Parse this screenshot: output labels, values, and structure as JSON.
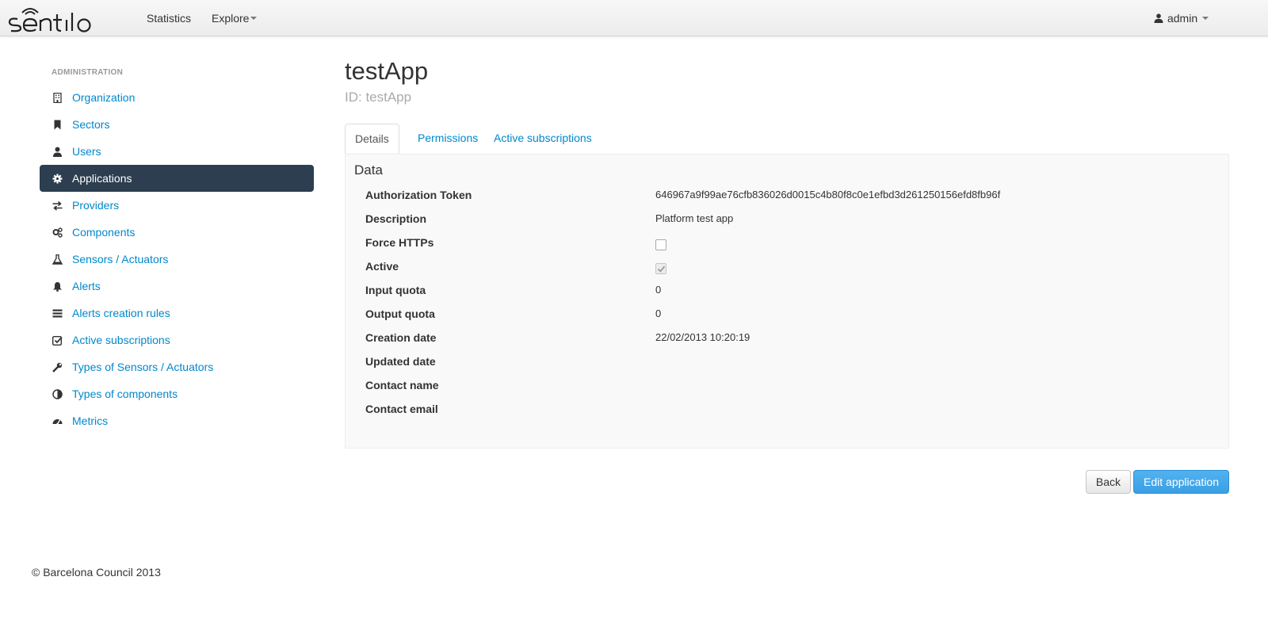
{
  "brand": {
    "name": "sentilo"
  },
  "navbar": {
    "statistics": "Statistics",
    "explore": "Explore",
    "user": "admin"
  },
  "sidebar": {
    "header": "ADMINISTRATION",
    "items": [
      {
        "label": "Organization",
        "icon": "building-icon"
      },
      {
        "label": "Sectors",
        "icon": "bookmark-icon"
      },
      {
        "label": "Users",
        "icon": "user-icon"
      },
      {
        "label": "Applications",
        "icon": "gear-icon"
      },
      {
        "label": "Providers",
        "icon": "exchange-icon"
      },
      {
        "label": "Components",
        "icon": "gears-icon"
      },
      {
        "label": "Sensors / Actuators",
        "icon": "flask-icon"
      },
      {
        "label": "Alerts",
        "icon": "bell-icon"
      },
      {
        "label": "Alerts creation rules",
        "icon": "list-icon"
      },
      {
        "label": "Active subscriptions",
        "icon": "check-square-icon"
      },
      {
        "label": "Types of Sensors / Actuators",
        "icon": "wrench-icon"
      },
      {
        "label": "Types of components",
        "icon": "half-circle-icon"
      },
      {
        "label": "Metrics",
        "icon": "gauge-icon"
      }
    ],
    "active_index": 3
  },
  "main": {
    "title": "testApp",
    "subtitle": "ID: testApp",
    "tabs": [
      {
        "label": "Details"
      },
      {
        "label": "Permissions"
      },
      {
        "label": "Active subscriptions"
      }
    ],
    "panel": {
      "title": "Data",
      "fields": {
        "auth_token": {
          "label": "Authorization Token",
          "value": "646967a9f99ae76cfb836026d0015c4b80f8c0e1efbd3d261250156efd8fb96f"
        },
        "description": {
          "label": "Description",
          "value": "Platform test app"
        },
        "force_https": {
          "label": "Force HTTPs",
          "checked": false
        },
        "active": {
          "label": "Active",
          "checked": true
        },
        "input_quota": {
          "label": "Input quota",
          "value": "0"
        },
        "output_quota": {
          "label": "Output quota",
          "value": "0"
        },
        "creation_date": {
          "label": "Creation date",
          "value": "22/02/2013 10:20:19"
        },
        "updated_date": {
          "label": "Updated date",
          "value": ""
        },
        "contact_name": {
          "label": "Contact name",
          "value": ""
        },
        "contact_email": {
          "label": "Contact email",
          "value": ""
        }
      }
    },
    "buttons": {
      "back": "Back",
      "edit": "Edit application"
    }
  },
  "footer": {
    "text": "© Barcelona Council 2013"
  },
  "colors": {
    "link": "#0088cc",
    "active_nav": "#2c3e50",
    "primary_button": "#3a9fe4"
  }
}
